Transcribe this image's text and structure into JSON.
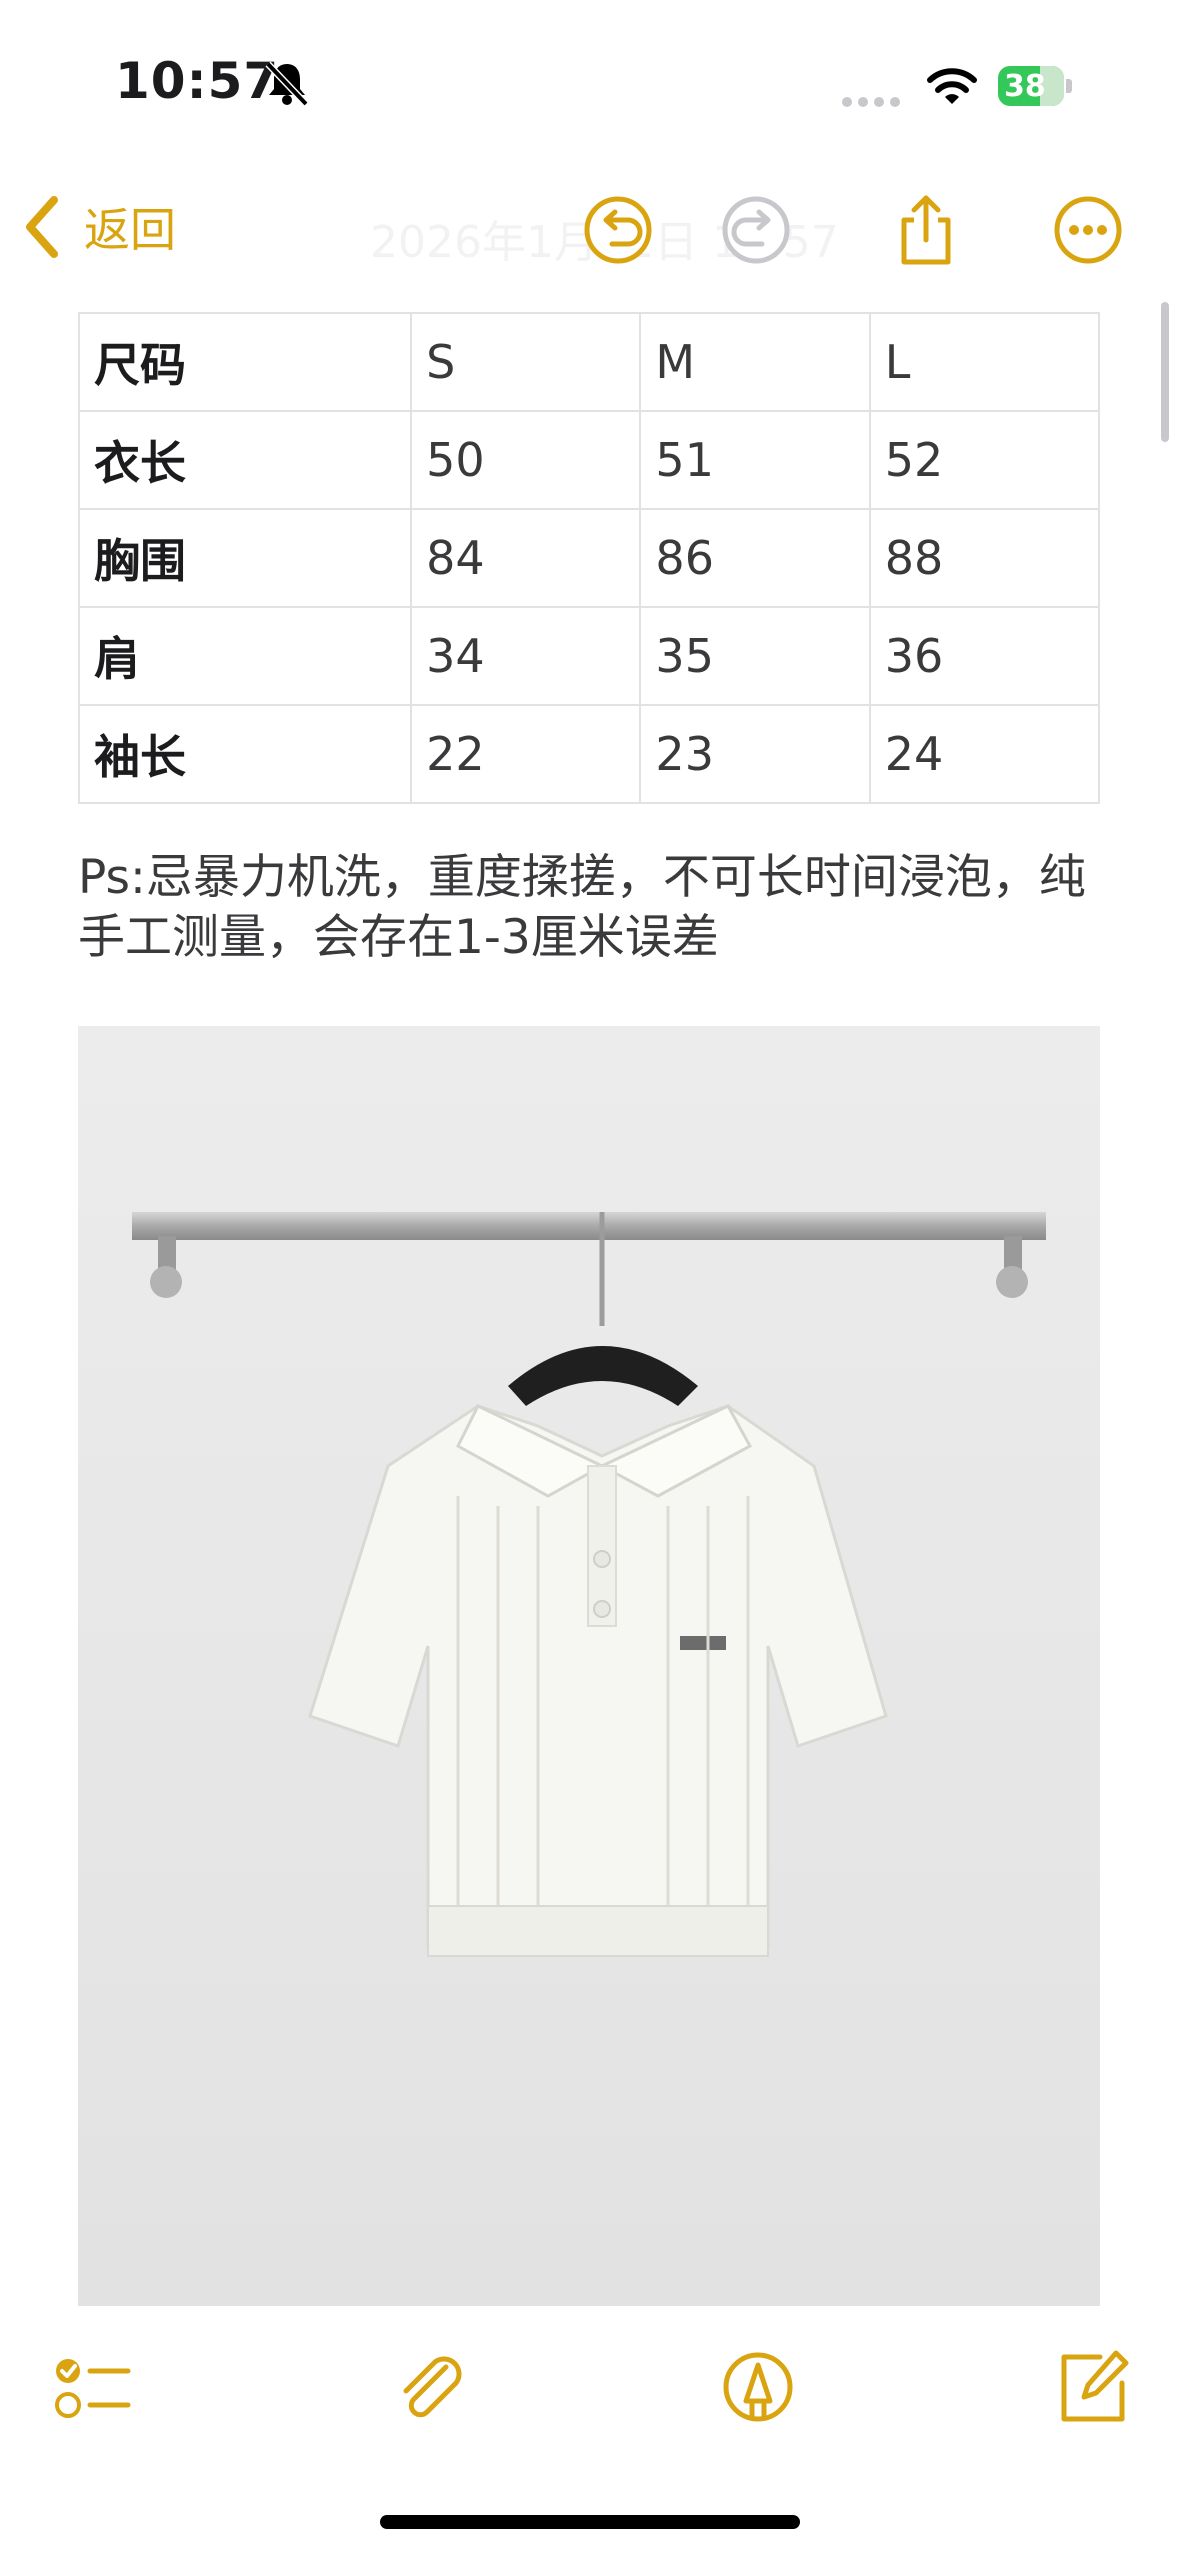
{
  "status": {
    "time": "10:57",
    "battery": "38"
  },
  "nav": {
    "back_label": "返回",
    "title": "2026年1月11日 10:57"
  },
  "table": {
    "rows": [
      [
        "尺码",
        "S",
        "M",
        "L"
      ],
      [
        "衣长",
        "50",
        "51",
        "52"
      ],
      [
        "胸围",
        "84",
        "86",
        "88"
      ],
      [
        "肩",
        "34",
        "35",
        "36"
      ],
      [
        "袖长",
        "22",
        "23",
        "24"
      ]
    ]
  },
  "note": {
    "text": "Ps:忌暴力机洗，重度揉搓，不可长时间浸泡，纯手工测量，会存在1-3厘米误差"
  },
  "colors": {
    "accent": "#d9a40f",
    "battery": "#34c759"
  },
  "icons": {
    "undo": "undo-icon",
    "redo": "redo-icon",
    "share": "share-icon",
    "more": "more-icon",
    "checklist": "checklist-icon",
    "attach": "paperclip-icon",
    "markup": "markup-pen-icon",
    "compose": "compose-icon"
  }
}
